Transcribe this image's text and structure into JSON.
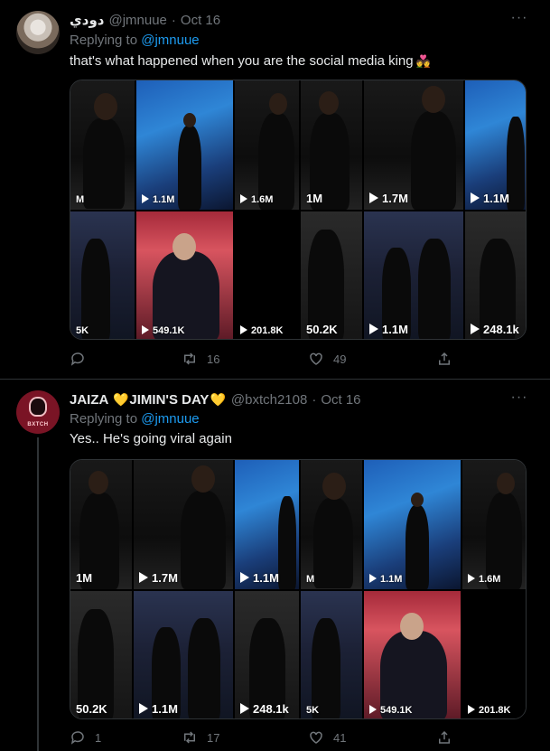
{
  "tweets": [
    {
      "display_name": "دودي",
      "handle": "@jmnuue",
      "separator": "·",
      "date": "Oct 16",
      "replying_prefix": "Replying to",
      "replying_to": "@jmnuue",
      "text": "that's what happened when you are the social media king",
      "emoji": "💑",
      "more": "···",
      "media_views": [
        "M",
        "1.1M",
        "1.6M",
        "1M",
        "1.7M",
        "1.1M",
        "5K",
        "549.1K",
        "201.8K",
        "50.2K",
        "1.1M",
        "248.1k"
      ],
      "reply_count": "",
      "retweet_count": "16",
      "like_count": "49"
    },
    {
      "display_name_part1": "JAIZA",
      "heart": "💛",
      "display_name_part2": "JIMIN'S DAY",
      "handle": "@bxtch2108",
      "separator": "·",
      "date": "Oct 16",
      "replying_prefix": "Replying to",
      "replying_to": "@jmnuue",
      "text": "Yes.. He's going viral again",
      "more": "···",
      "avatar_text": "BXTCH",
      "media_views": [
        "1M",
        "1.7M",
        "1.1M",
        "M",
        "1.1M",
        "1.6M",
        "50.2K",
        "1.1M",
        "248.1k",
        "5K",
        "549.1K",
        "201.8K"
      ],
      "reply_count": "1",
      "retweet_count": "17",
      "like_count": "41"
    }
  ],
  "colors": {
    "background": "#000000",
    "text": "#e7e9ea",
    "secondary": "#71767b",
    "link": "#1d9bf0",
    "divider": "#2f3336"
  }
}
